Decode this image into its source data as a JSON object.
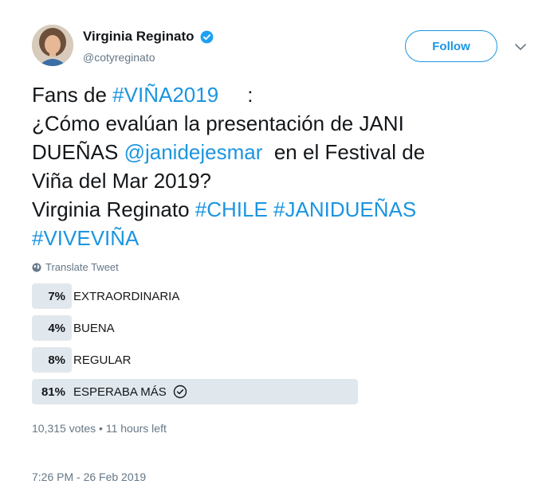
{
  "author": {
    "name": "Virginia Reginato",
    "handle": "@cotyreginato",
    "verified": true
  },
  "follow_label": "Follow",
  "icons": {
    "verified": "verified-badge-icon",
    "caret": "chevron-down-icon",
    "globe": "globe-icon",
    "check": "check-circle-icon"
  },
  "colors": {
    "link": "#1b95e0",
    "poll_bar": "#e1e8ed",
    "muted": "#657786"
  },
  "text": {
    "l1a": "Fans de ",
    "l1b": "#VIÑA2019",
    "l1c": "     :",
    "l2": "¿Cómo evalúan la presentación de JANI",
    "l3a": "DUEÑAS ",
    "l3b": "@janidejesmar",
    "l3c": "  en el Festival de",
    "l4": "Viña del Mar 2019?",
    "l5a": "Virginia Reginato ",
    "l5b": "#CHILE",
    "l5c": " ",
    "l5d": "#JANIDUEÑAS",
    "l6": "#VIVEVIÑA"
  },
  "translate_label": "Translate Tweet",
  "poll": {
    "options": [
      {
        "percent": "7%",
        "label": "EXTRAORDINARIA",
        "fraction": 0.07
      },
      {
        "percent": "4%",
        "label": "BUENA",
        "fraction": 0.04
      },
      {
        "percent": "8%",
        "label": "REGULAR",
        "fraction": 0.08
      },
      {
        "percent": "81%",
        "label": "ESPERABA MÁS",
        "fraction": 0.81,
        "winner": true
      }
    ],
    "meta": "10,315 votes • 11 hours left"
  },
  "timestamp": "7:26 PM - 26 Feb 2019"
}
